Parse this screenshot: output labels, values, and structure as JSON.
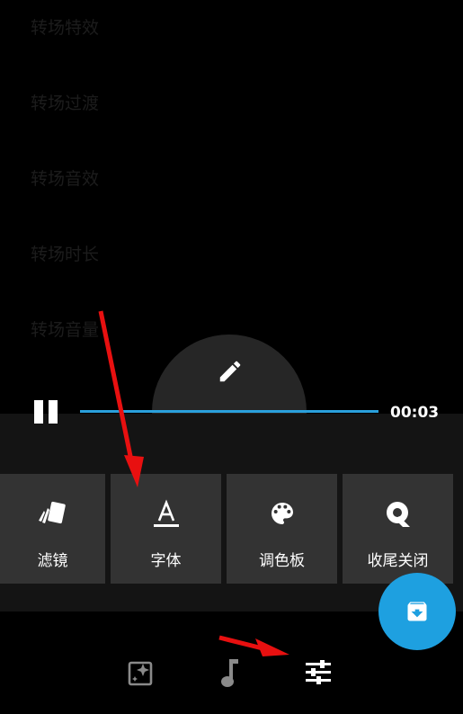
{
  "background_list": [
    "转场特效",
    "转场过渡",
    "转场音效",
    "转场时长",
    "转场音量"
  ],
  "player": {
    "time": "00:03",
    "progress": 1.0
  },
  "tools": [
    {
      "label": "滤镜",
      "icon": "filter-cards-icon"
    },
    {
      "label": "字体",
      "icon": "font-icon"
    },
    {
      "label": "调色板",
      "icon": "palette-icon"
    },
    {
      "label": "收尾关闭",
      "icon": "ending-icon"
    }
  ],
  "fab": {
    "icon": "archive-download-icon",
    "color": "#1ea0e0"
  },
  "bottom_nav": [
    {
      "icon": "photo-sparkle-icon"
    },
    {
      "icon": "music-note-icon"
    },
    {
      "icon": "sliders-icon"
    }
  ],
  "annotation_color": "#e81010"
}
